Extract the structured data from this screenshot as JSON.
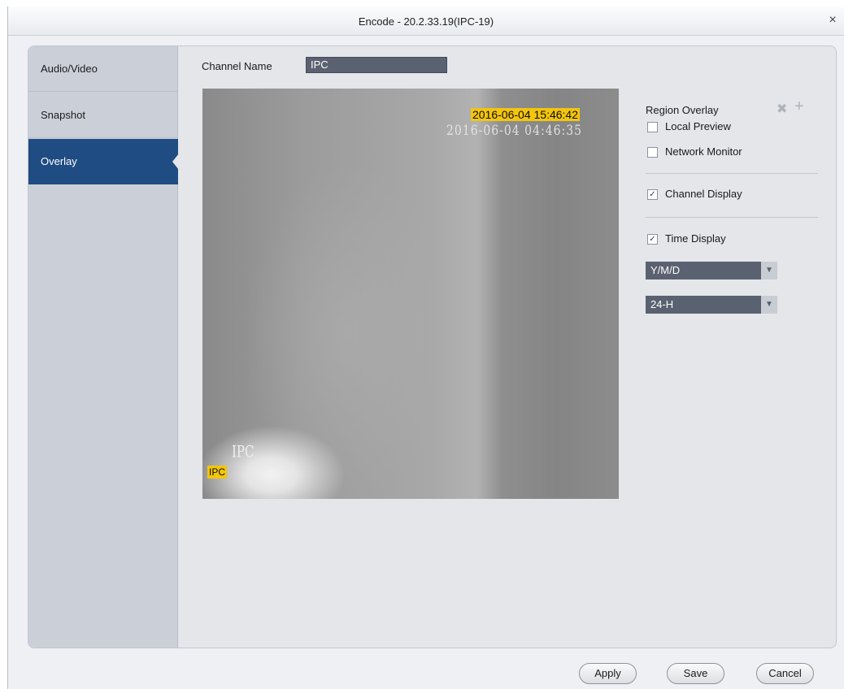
{
  "window": {
    "title": "Encode  - 20.2.33.19(IPC-19)",
    "close_glyph": "×"
  },
  "sidebar": {
    "items": [
      {
        "label": "Audio/Video",
        "active": false
      },
      {
        "label": "Snapshot",
        "active": false
      },
      {
        "label": "Overlay",
        "active": true
      }
    ]
  },
  "channel": {
    "label": "Channel Name",
    "value": "IPC"
  },
  "preview": {
    "time_overlay": "2016-06-04 15:46:42",
    "channel_overlay": "IPC",
    "camera_time_text": "2016-06-04 04:46:35",
    "camera_channel_text": "IPC"
  },
  "region_overlay": {
    "label": "Region Overlay",
    "delete_icon": "✖",
    "add_icon": "+",
    "local_preview": {
      "label": "Local Preview",
      "checked": false
    },
    "network_monitor": {
      "label": "Network Monitor",
      "checked": false
    }
  },
  "channel_display": {
    "label": "Channel Display",
    "checked": true,
    "mark": "✓"
  },
  "time_display": {
    "label": "Time Display",
    "checked": true,
    "mark": "✓"
  },
  "date_format": {
    "selected": "Y/M/D",
    "arrow": "▼"
  },
  "hour_format": {
    "selected": "24-H",
    "arrow": "▼"
  },
  "buttons": {
    "apply": "Apply",
    "save": "Save",
    "cancel": "Cancel"
  },
  "colors": {
    "active_tab": "#1f4c82",
    "overlay_box": "#f3c50c",
    "field_bg": "#5a6170"
  }
}
